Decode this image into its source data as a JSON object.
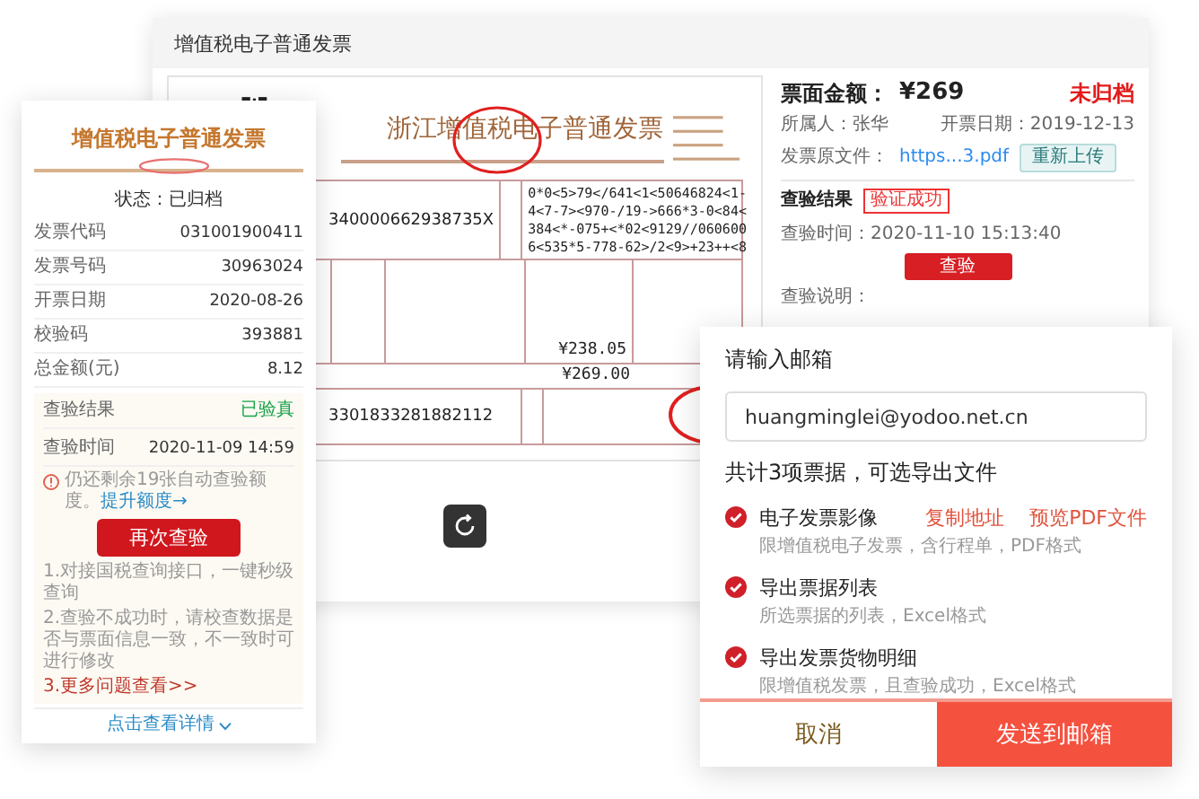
{
  "main_window": {
    "title": "增值税电子普通发票"
  },
  "invoice": {
    "title": "浙江增值税电子普通发票",
    "buyer_tax_id": "340000662938735X",
    "cipher_lines": [
      "0*0<5>79</641<1<50646824<1-",
      "4<7-7><970-/19->666*3-0<84<",
      "384<*-075+<*02<9129//060600",
      "6<535*5-778-62>/2<9>+23++<8"
    ],
    "subtotal": "¥238.05",
    "total": "¥269.00",
    "seller_tax_id": "3301833281882112"
  },
  "details": {
    "amount_label": "票面金额：",
    "amount": "¥269",
    "archive_status": "未归档",
    "owner": "所属人：张华",
    "issue_date": "开票日期：2019-12-13",
    "file_label": "发票原文件：",
    "file_link": "https...3.pdf",
    "reupload_button": "重新上传",
    "check_label": "查验结果",
    "check_badge": "验证成功",
    "check_time": "查验时间：2020-11-10 15:13:40",
    "check_button": "查验",
    "note_label": "查验说明："
  },
  "mobile_card": {
    "title": "增值税电子普通发票",
    "status": "状态：已归档",
    "rows": [
      {
        "label": "发票代码",
        "value": "031001900411"
      },
      {
        "label": "发票号码",
        "value": "30963024"
      },
      {
        "label": "开票日期",
        "value": "2020-08-26"
      },
      {
        "label": "校验码",
        "value": "393881"
      },
      {
        "label": "总金额(元)",
        "value": "8.12"
      }
    ],
    "check_rows": [
      {
        "label": "查验结果",
        "value": "已验真",
        "kind": "result"
      },
      {
        "label": "查验时间",
        "value": "2020-11-09 14:59",
        "kind": "plain"
      }
    ],
    "notice": "仍还剩余19张自动查验额度。",
    "notice_link": "提升额度→",
    "recheck_button": "再次查验",
    "tips": [
      "1.对接国税查询接口，一键秒级查询",
      "2.查验不成功时，请校查数据是否与票面信息一致，不一致时可进行修改"
    ],
    "more_link": "3.更多问题查看>>",
    "details_link": "点击查看详情"
  },
  "email_dialog": {
    "title": "请输入邮箱",
    "email": "huangminglei@yodoo.net.cn",
    "summary": "共计3项票据，可选导出文件",
    "options": [
      {
        "title": "电子发票影像",
        "description": "限增值税电子发票，含行程单，PDF格式",
        "checked": true,
        "actions": [
          "复制地址",
          "预览PDF文件"
        ]
      },
      {
        "title": "导出票据列表",
        "description": "所选票据的列表，Excel格式",
        "checked": true
      },
      {
        "title": "导出发票货物明细",
        "description": "限增值税发票，且查验成功，Excel格式",
        "checked": true
      }
    ],
    "cancel_button": "取消",
    "send_button": "发送到邮箱"
  }
}
